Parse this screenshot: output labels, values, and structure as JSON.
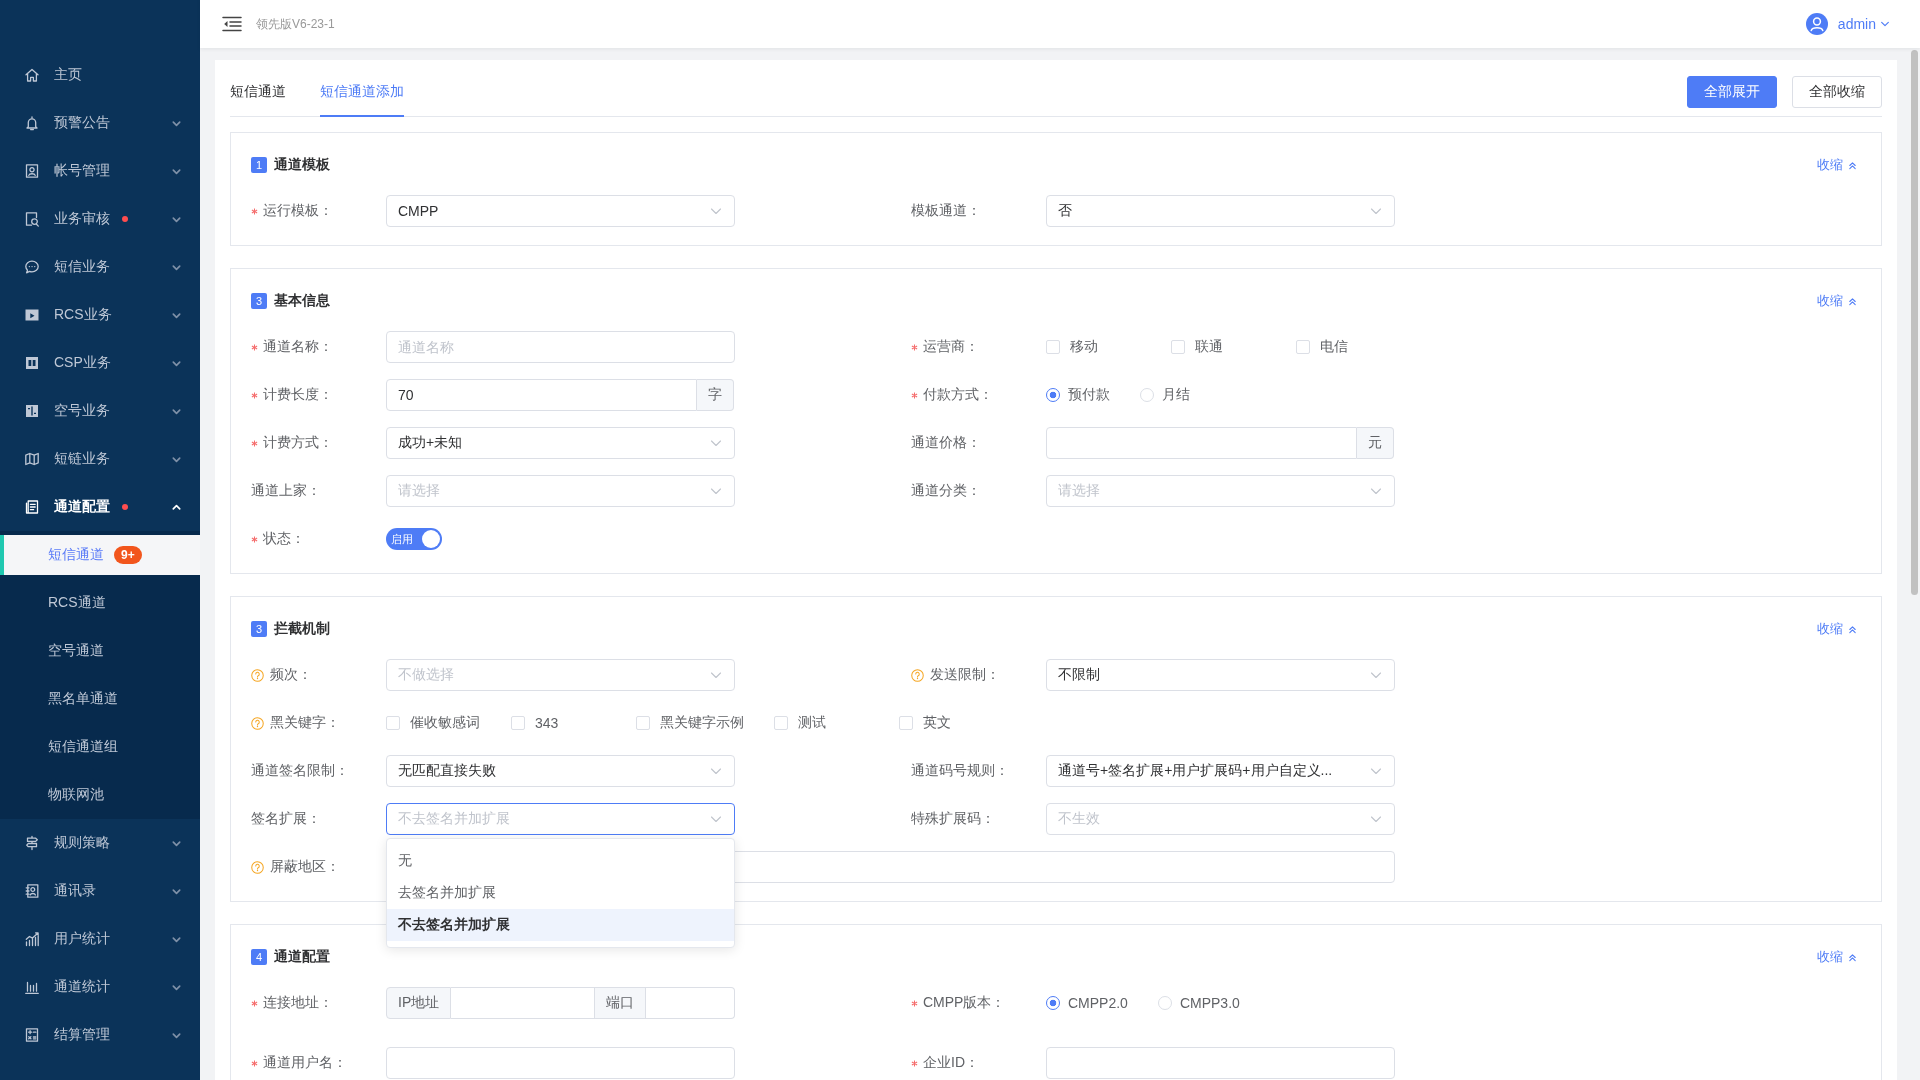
{
  "sidebar": {
    "items": [
      {
        "label": "主页",
        "kind": "link",
        "dot": false
      },
      {
        "label": "预警公告",
        "kind": "group",
        "expanded": false,
        "dot": false
      },
      {
        "label": "帐号管理",
        "kind": "group",
        "expanded": false,
        "dot": false
      },
      {
        "label": "业务审核",
        "kind": "group",
        "expanded": false,
        "dot": true
      },
      {
        "label": "短信业务",
        "kind": "group",
        "expanded": false,
        "dot": false
      },
      {
        "label": "RCS业务",
        "kind": "group",
        "expanded": false,
        "dot": false
      },
      {
        "label": "CSP业务",
        "kind": "group",
        "expanded": false,
        "dot": false
      },
      {
        "label": "空号业务",
        "kind": "group",
        "expanded": false,
        "dot": false
      },
      {
        "label": "短链业务",
        "kind": "group",
        "expanded": false,
        "dot": false
      },
      {
        "label": "通道配置",
        "kind": "group",
        "expanded": true,
        "dot": true,
        "children": [
          {
            "label": "短信通道",
            "selected": true,
            "badge": "9+"
          },
          {
            "label": "RCS通道",
            "selected": false
          },
          {
            "label": "空号通道",
            "selected": false
          },
          {
            "label": "黑名单通道",
            "selected": false
          },
          {
            "label": "短信通道组",
            "selected": false
          },
          {
            "label": "物联网池",
            "selected": false
          }
        ]
      },
      {
        "label": "规则策略",
        "kind": "group",
        "expanded": false,
        "dot": false
      },
      {
        "label": "通讯录",
        "kind": "group",
        "expanded": false,
        "dot": false
      },
      {
        "label": "用户统计",
        "kind": "group",
        "expanded": false,
        "dot": false
      },
      {
        "label": "通道统计",
        "kind": "group",
        "expanded": false,
        "dot": false
      },
      {
        "label": "结算管理",
        "kind": "group",
        "expanded": false,
        "dot": false
      }
    ]
  },
  "header": {
    "version": "领先版V6-23-1",
    "user": "admin"
  },
  "tabs": [
    {
      "label": "短信通道",
      "selected": false
    },
    {
      "label": "短信通道添加",
      "selected": true
    }
  ],
  "actions": [
    {
      "label": "全部展开",
      "kind": "primary"
    },
    {
      "label": "全部收缩",
      "kind": "plain"
    }
  ],
  "sections": [
    {
      "number": "1",
      "title": "通道模板",
      "collapse": "收缩",
      "rows": [
        [
          {
            "label": "运行模板：",
            "required": true,
            "help": false,
            "kind": "select",
            "value": "CMPP",
            "open": false
          },
          {
            "label": "模板通道：",
            "required": false,
            "help": false,
            "kind": "select",
            "value": "否",
            "open": false
          }
        ]
      ]
    },
    {
      "number": "3",
      "title": "基本信息",
      "collapse": "收缩",
      "rows": [
        [
          {
            "label": "通道名称：",
            "required": true,
            "help": false,
            "kind": "input",
            "placeholder": "通道名称"
          },
          {
            "label": "运营商：",
            "required": true,
            "help": false,
            "kind": "checkboxes",
            "options": [
              {
                "label": "移动",
                "checked": false
              },
              {
                "label": "联通",
                "checked": false
              },
              {
                "label": "电信",
                "checked": false
              }
            ]
          }
        ],
        [
          {
            "label": "计费长度：",
            "required": true,
            "help": false,
            "kind": "input",
            "value": "70",
            "suffix": "字"
          },
          {
            "label": "付款方式：",
            "required": true,
            "help": false,
            "kind": "radios",
            "options": [
              {
                "label": "预付款",
                "selected": true
              },
              {
                "label": "月结",
                "selected": false
              }
            ]
          }
        ],
        [
          {
            "label": "计费方式：",
            "required": true,
            "help": false,
            "kind": "select",
            "value": "成功+未知",
            "open": false
          },
          {
            "label": "通道价格：",
            "required": false,
            "help": false,
            "kind": "input",
            "suffix": "元"
          }
        ],
        [
          {
            "label": "通道上家：",
            "required": false,
            "help": false,
            "kind": "select",
            "placeholder": "请选择",
            "open": false
          },
          {
            "label": "通道分类：",
            "required": false,
            "help": false,
            "kind": "select",
            "placeholder": "请选择",
            "open": false
          }
        ],
        [
          {
            "label": "状态：",
            "required": true,
            "help": false,
            "kind": "switch",
            "on": true,
            "text": "启用"
          }
        ]
      ]
    },
    {
      "number": "3",
      "title": "拦截机制",
      "collapse": "收缩",
      "rows": [
        [
          {
            "label": "频次：",
            "required": false,
            "help": true,
            "kind": "select",
            "placeholder": "不做选择",
            "open": false
          },
          {
            "label": "发送限制：",
            "required": false,
            "help": true,
            "kind": "select",
            "value": "不限制",
            "open": false
          }
        ],
        [
          {
            "label": "黑关键字：",
            "required": false,
            "help": true,
            "kind": "checkboxes",
            "options": [
              {
                "label": "催收敏感词",
                "checked": false
              },
              {
                "label": "343",
                "checked": false
              },
              {
                "label": "黑关键字示例",
                "checked": false
              },
              {
                "label": "测试",
                "checked": false
              },
              {
                "label": "英文",
                "checked": false
              }
            ]
          }
        ],
        [
          {
            "label": "通道签名限制：",
            "required": false,
            "help": false,
            "kind": "select",
            "value": "无匹配直接失败",
            "open": false
          },
          {
            "label": "通道码号规则：",
            "required": false,
            "help": false,
            "kind": "select",
            "value": "通道号+签名扩展+用户扩展码+用户自定义...",
            "open": false
          }
        ],
        [
          {
            "label": "签名扩展：",
            "required": false,
            "help": false,
            "kind": "select",
            "placeholder": "不去签名并加扩展",
            "open": true
          },
          {
            "label": "特殊扩展码：",
            "required": false,
            "help": false,
            "kind": "select",
            "placeholder": "不生效",
            "open": false
          }
        ],
        [
          {
            "label": "屏蔽地区：",
            "required": false,
            "help": true,
            "kind": "input"
          }
        ]
      ]
    },
    {
      "number": "4",
      "title": "通道配置",
      "collapse": "收缩",
      "rows": [
        [
          {
            "label": "连接地址：",
            "required": true,
            "help": false,
            "kind": "address",
            "addons": [
              "IP地址",
              "端口"
            ]
          },
          {
            "label": "CMPP版本：",
            "required": true,
            "help": false,
            "kind": "radios",
            "options": [
              {
                "label": "CMPP2.0",
                "selected": true
              },
              {
                "label": "CMPP3.0",
                "selected": false
              }
            ]
          }
        ],
        [
          {
            "label": "通道用户名：",
            "required": true,
            "help": false,
            "kind": "input"
          },
          {
            "label": "企业ID：",
            "required": true,
            "help": false,
            "kind": "input"
          }
        ]
      ]
    }
  ],
  "dropdown": {
    "options": [
      {
        "label": "无",
        "selected": false
      },
      {
        "label": "去签名并加扩展",
        "selected": false
      },
      {
        "label": "不去签名并加扩展",
        "selected": true
      }
    ]
  }
}
